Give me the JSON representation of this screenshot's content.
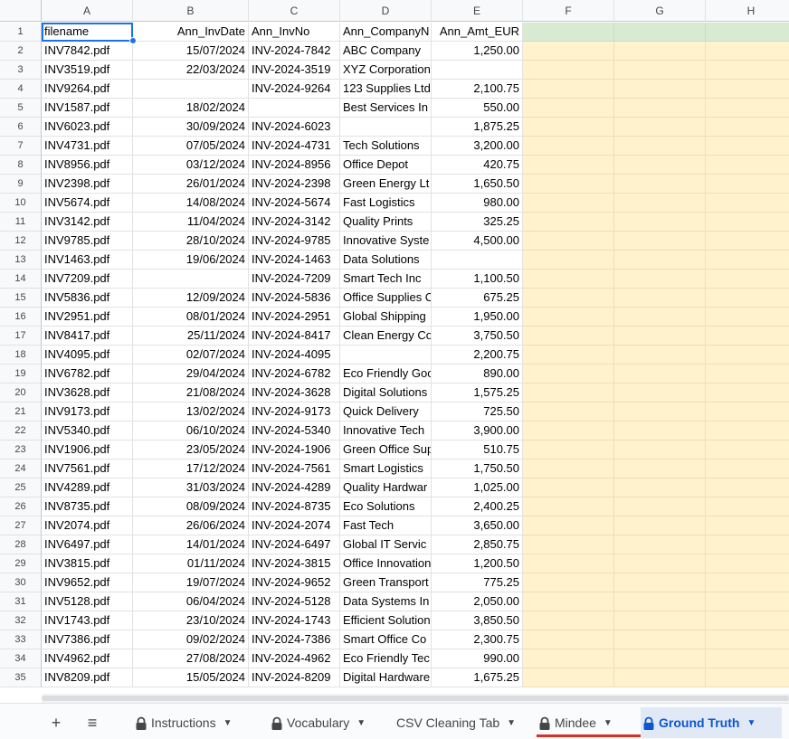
{
  "columns": [
    "A",
    "B",
    "C",
    "D",
    "E",
    "F",
    "G",
    "H"
  ],
  "header": [
    "filename",
    "Ann_InvDate",
    "Ann_InvNo",
    "Ann_CompanyN",
    "Ann_Amt_EUR"
  ],
  "rows": [
    [
      "INV7842.pdf",
      "15/07/2024",
      "INV-2024-7842",
      "ABC Company",
      "1,250.00"
    ],
    [
      "INV3519.pdf",
      "22/03/2024",
      "INV-2024-3519",
      "XYZ Corporation",
      ""
    ],
    [
      "INV9264.pdf",
      "",
      "INV-2024-9264",
      "123 Supplies Ltd",
      "2,100.75"
    ],
    [
      "INV1587.pdf",
      "18/02/2024",
      "",
      "Best Services In",
      "550.00"
    ],
    [
      "INV6023.pdf",
      "30/09/2024",
      "INV-2024-6023",
      "",
      "1,875.25"
    ],
    [
      "INV4731.pdf",
      "07/05/2024",
      "INV-2024-4731",
      "Tech Solutions",
      "3,200.00"
    ],
    [
      "INV8956.pdf",
      "03/12/2024",
      "INV-2024-8956",
      "Office Depot",
      "420.75"
    ],
    [
      "INV2398.pdf",
      "26/01/2024",
      "INV-2024-2398",
      "Green Energy Lt",
      "1,650.50"
    ],
    [
      "INV5674.pdf",
      "14/08/2024",
      "INV-2024-5674",
      "Fast Logistics",
      "980.00"
    ],
    [
      "INV3142.pdf",
      "11/04/2024",
      "INV-2024-3142",
      "Quality Prints",
      "325.25"
    ],
    [
      "INV9785.pdf",
      "28/10/2024",
      "INV-2024-9785",
      "Innovative Syste",
      "4,500.00"
    ],
    [
      "INV1463.pdf",
      "19/06/2024",
      "INV-2024-1463",
      "Data Solutions",
      ""
    ],
    [
      "INV7209.pdf",
      "",
      "INV-2024-7209",
      "Smart Tech Inc",
      "1,100.50"
    ],
    [
      "INV5836.pdf",
      "12/09/2024",
      "INV-2024-5836",
      "Office Supplies C",
      "675.25"
    ],
    [
      "INV2951.pdf",
      "08/01/2024",
      "INV-2024-2951",
      "Global Shipping",
      "1,950.00"
    ],
    [
      "INV8417.pdf",
      "25/11/2024",
      "INV-2024-8417",
      "Clean Energy Co",
      "3,750.50"
    ],
    [
      "INV4095.pdf",
      "02/07/2024",
      "INV-2024-4095",
      "",
      "2,200.75"
    ],
    [
      "INV6782.pdf",
      "29/04/2024",
      "INV-2024-6782",
      "Eco Friendly Goo",
      "890.00"
    ],
    [
      "INV3628.pdf",
      "21/08/2024",
      "INV-2024-3628",
      "Digital Solutions",
      "1,575.25"
    ],
    [
      "INV9173.pdf",
      "13/02/2024",
      "INV-2024-9173",
      "Quick Delivery",
      "725.50"
    ],
    [
      "INV5340.pdf",
      "06/10/2024",
      "INV-2024-5340",
      "Innovative Tech",
      "3,900.00"
    ],
    [
      "INV1906.pdf",
      "23/05/2024",
      "INV-2024-1906",
      "Green Office Sup",
      "510.75"
    ],
    [
      "INV7561.pdf",
      "17/12/2024",
      "INV-2024-7561",
      "Smart Logistics",
      "1,750.50"
    ],
    [
      "INV4289.pdf",
      "31/03/2024",
      "INV-2024-4289",
      "Quality Hardwar",
      "1,025.00"
    ],
    [
      "INV8735.pdf",
      "08/09/2024",
      "INV-2024-8735",
      "Eco Solutions",
      "2,400.25"
    ],
    [
      "INV2074.pdf",
      "26/06/2024",
      "INV-2024-2074",
      "Fast Tech",
      "3,650.00"
    ],
    [
      "INV6497.pdf",
      "14/01/2024",
      "INV-2024-6497",
      "Global IT Servic",
      "2,850.75"
    ],
    [
      "INV3815.pdf",
      "01/11/2024",
      "INV-2024-3815",
      "Office Innovation",
      "1,200.50"
    ],
    [
      "INV9652.pdf",
      "19/07/2024",
      "INV-2024-9652",
      "Green Transport",
      "775.25"
    ],
    [
      "INV5128.pdf",
      "06/04/2024",
      "INV-2024-5128",
      "Data Systems In",
      "2,050.00"
    ],
    [
      "INV1743.pdf",
      "23/10/2024",
      "INV-2024-1743",
      "Efficient Solution",
      "3,850.50"
    ],
    [
      "INV7386.pdf",
      "09/02/2024",
      "INV-2024-7386",
      "Smart Office Co",
      "2,300.75"
    ],
    [
      "INV4962.pdf",
      "27/08/2024",
      "INV-2024-4962",
      "Eco Friendly Tec",
      "990.00"
    ],
    [
      "INV8209.pdf",
      "15/05/2024",
      "INV-2024-8209",
      "Digital Hardware",
      "1,675.25"
    ]
  ],
  "tabs": [
    {
      "label": "Instructions",
      "locked": true,
      "active": false
    },
    {
      "label": "Vocabulary",
      "locked": true,
      "active": false
    },
    {
      "label": "CSV Cleaning Tab",
      "locked": false,
      "active": false
    },
    {
      "label": "Mindee",
      "locked": true,
      "active": false
    },
    {
      "label": "Ground Truth",
      "locked": true,
      "active": true
    }
  ],
  "toolbar": {
    "add_sheet": "+",
    "all_sheets": "≡"
  },
  "colors": {
    "accent": "#1a73e8",
    "highlight_yellow": "#fff2cc",
    "highlight_green": "#d9ead3",
    "tab_active": "#0b57d0",
    "mindee_underline": "#d93025"
  }
}
